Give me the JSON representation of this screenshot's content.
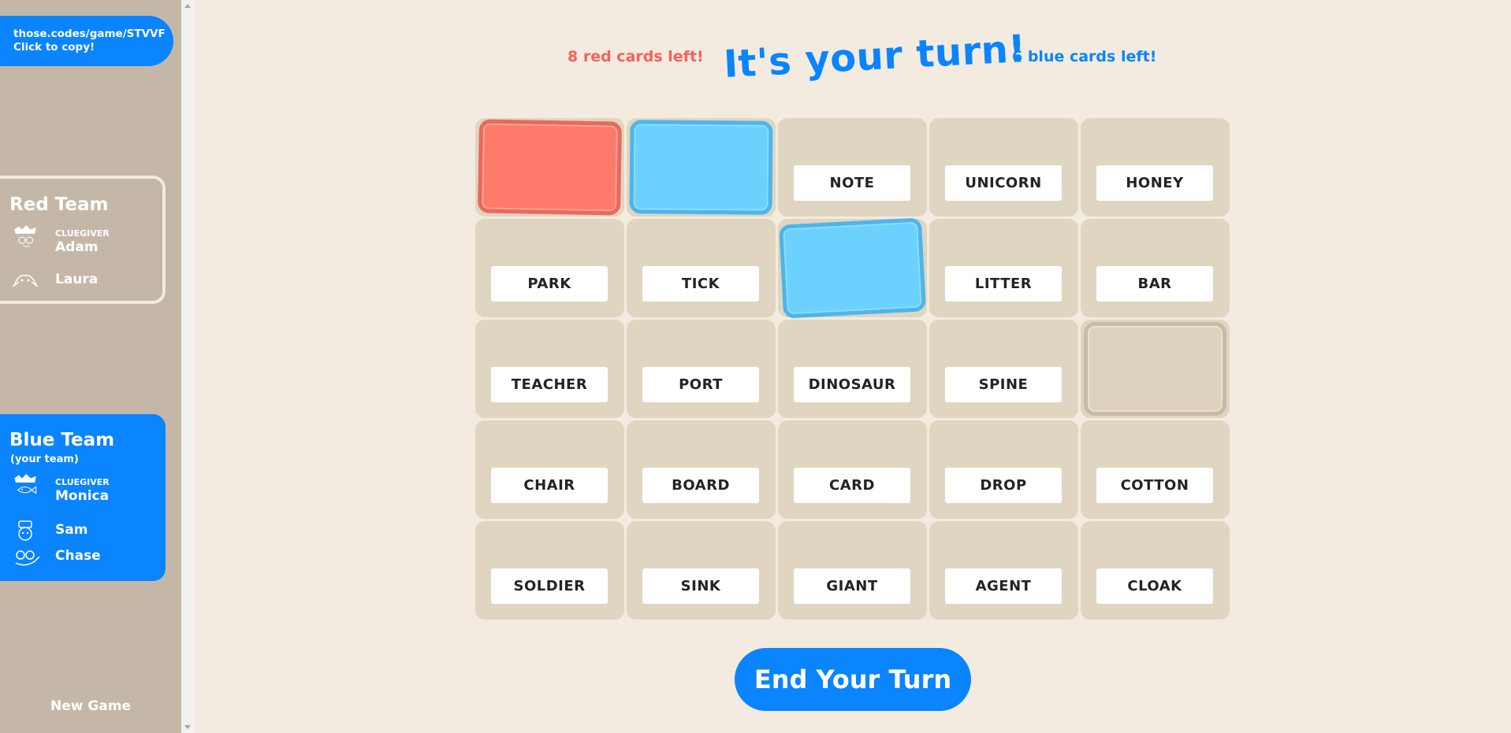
{
  "sidebar": {
    "game_link": {
      "line1": "those.codes/game/STVVF",
      "line2": "Click to copy!"
    },
    "red_team": {
      "name": "Red Team",
      "players": [
        {
          "name": "Adam",
          "role": "CLUEGIVER",
          "avatar": "crown-face-icon"
        },
        {
          "name": "Laura",
          "role": "",
          "avatar": "crab-face-icon"
        }
      ]
    },
    "blue_team": {
      "name": "Blue Team",
      "subtitle": "(your team)",
      "players": [
        {
          "name": "Monica",
          "role": "CLUEGIVER",
          "avatar": "crown-fish-icon"
        },
        {
          "name": "Sam",
          "role": "",
          "avatar": "hat-face-icon"
        },
        {
          "name": "Chase",
          "role": "",
          "avatar": "glasses-face-icon"
        }
      ]
    },
    "new_game": "New Game"
  },
  "header": {
    "red_left": "8 red cards left!",
    "turn_title": "It's your turn!",
    "blue_left": "6 blue cards left!"
  },
  "board": {
    "rows": [
      [
        {
          "word": "",
          "state": "red"
        },
        {
          "word": "",
          "state": "blue"
        },
        {
          "word": "NOTE",
          "state": "hidden"
        },
        {
          "word": "UNICORN",
          "state": "hidden"
        },
        {
          "word": "HONEY",
          "state": "hidden"
        }
      ],
      [
        {
          "word": "PARK",
          "state": "hidden"
        },
        {
          "word": "TICK",
          "state": "hidden"
        },
        {
          "word": "",
          "state": "blue"
        },
        {
          "word": "LITTER",
          "state": "hidden"
        },
        {
          "word": "BAR",
          "state": "hidden"
        }
      ],
      [
        {
          "word": "TEACHER",
          "state": "hidden"
        },
        {
          "word": "PORT",
          "state": "hidden"
        },
        {
          "word": "DINOSAUR",
          "state": "hidden"
        },
        {
          "word": "SPINE",
          "state": "hidden"
        },
        {
          "word": "",
          "state": "neutral"
        }
      ],
      [
        {
          "word": "CHAIR",
          "state": "hidden"
        },
        {
          "word": "BOARD",
          "state": "hidden"
        },
        {
          "word": "CARD",
          "state": "hidden"
        },
        {
          "word": "DROP",
          "state": "hidden"
        },
        {
          "word": "COTTON",
          "state": "hidden"
        }
      ],
      [
        {
          "word": "SOLDIER",
          "state": "hidden"
        },
        {
          "word": "SINK",
          "state": "hidden"
        },
        {
          "word": "GIANT",
          "state": "hidden"
        },
        {
          "word": "AGENT",
          "state": "hidden"
        },
        {
          "word": "CLOAK",
          "state": "hidden"
        }
      ]
    ]
  },
  "end_turn_label": "End Your Turn",
  "colors": {
    "background": "#f3ebdf",
    "sidebar": "#c5b7a7",
    "blue_accent": "#0a84ff",
    "red_accent": "#f5615a",
    "card_red": "#fe7b6c",
    "card_blue": "#6cd1ff",
    "cell": "#e0d5c1"
  }
}
